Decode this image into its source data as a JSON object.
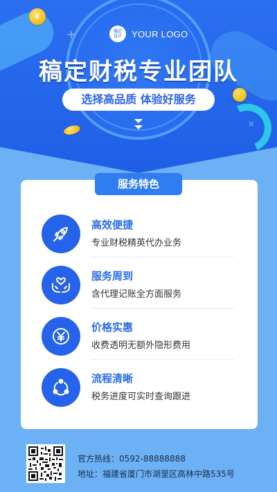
{
  "header": {
    "logo_badge": "稿定\n设计",
    "logo_text": "YOUR LOGO",
    "title": "稿定财税专业团队",
    "subtitle": "选择高品质 体验好服务"
  },
  "section_label": "服务特色",
  "items": [
    {
      "title": "高效便捷",
      "desc": "专业财税精英代办业务",
      "icon": "rocket-icon"
    },
    {
      "title": "服务周到",
      "desc": "含代理记账全方面服务",
      "icon": "heart-hands-icon"
    },
    {
      "title": "价格实惠",
      "desc": "收费透明无额外隐形费用",
      "icon": "yen-icon"
    },
    {
      "title": "流程清晰",
      "desc": "税务进度可实时查询跟进",
      "icon": "cycle-icon"
    }
  ],
  "footer": {
    "hotline": "官方热线：0592-88888888",
    "address": "地址：福建省厦门市湖里区高林中路535号"
  },
  "colors": {
    "primary": "#2563eb",
    "background": "#6cb0f5",
    "accent_gold": "#f7c21b"
  }
}
